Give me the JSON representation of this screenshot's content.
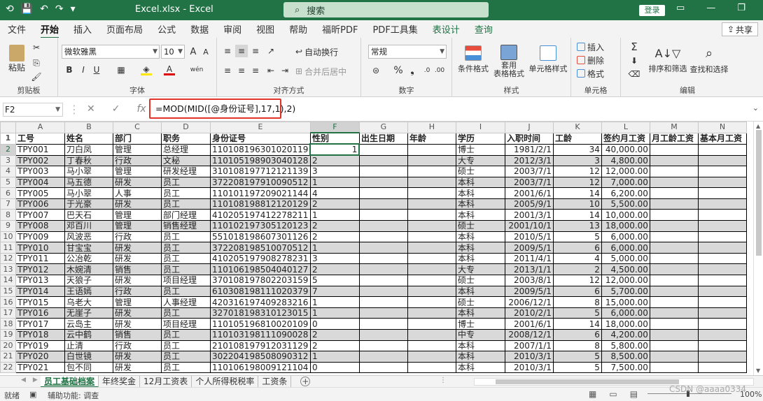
{
  "window": {
    "title": "Excel.xlsx  -  Excel",
    "search_placeholder": "搜索",
    "login": "登录"
  },
  "tabs": [
    "文件",
    "开始",
    "插入",
    "页面布局",
    "公式",
    "数据",
    "审阅",
    "视图",
    "帮助",
    "福昕PDF",
    "PDF工具集",
    "表设计",
    "查询"
  ],
  "share_label": "共享",
  "ribbon": {
    "clipboard": {
      "paste": "粘贴",
      "group": "剪贴板"
    },
    "font": {
      "name": "微软雅黑",
      "size": "10",
      "bold": "B",
      "italic": "I",
      "underline": "U",
      "group": "字体"
    },
    "alignment": {
      "wrap": "自动换行",
      "merge": "合并后居中",
      "group": "对齐方式"
    },
    "number": {
      "format": "常规",
      "group": "数字"
    },
    "styles": {
      "cond": "条件格式",
      "table": "套用\n表格格式",
      "cell": "单元格样式",
      "group": "样式"
    },
    "cells": {
      "insert": "插入",
      "delete": "删除",
      "format": "格式",
      "group": "单元格"
    },
    "editing": {
      "sortfilter": "排序和筛选",
      "findselect": "查找和选择",
      "group": "编辑"
    }
  },
  "formula_bar": {
    "namebox": "F2",
    "formula": "=MOD(MID([@身份证号],17,1),2)"
  },
  "columns": [
    "A",
    "B",
    "C",
    "D",
    "E",
    "F",
    "G",
    "H",
    "I",
    "J",
    "K",
    "L",
    "M",
    "N"
  ],
  "headers": [
    "工号",
    "姓名",
    "部门",
    "职务",
    "身份证号",
    "性别",
    "出生日期",
    "年龄",
    "学历",
    "入职时间",
    "工龄",
    "签约月工资",
    "月工龄工资",
    "基本月工资"
  ],
  "rows": [
    [
      "TPY001",
      "刀白凤",
      "管理",
      "总经理",
      "110108196301020119",
      "1",
      "",
      "",
      "博士",
      "1981/2/1",
      "34",
      "40,000.00",
      "",
      ""
    ],
    [
      "TPY002",
      "丁春秋",
      "行政",
      "文秘",
      "110105198903040128",
      "2",
      "",
      "",
      "大专",
      "2012/3/1",
      "3",
      "4,800.00",
      "",
      ""
    ],
    [
      "TPY003",
      "马小翠",
      "管理",
      "研发经理",
      "310108197712121139",
      "3",
      "",
      "",
      "硕士",
      "2003/7/1",
      "12",
      "12,000.00",
      "",
      ""
    ],
    [
      "TPY004",
      "马五德",
      "研发",
      "员工",
      "372208197910090512",
      "1",
      "",
      "",
      "本科",
      "2003/7/1",
      "12",
      "7,000.00",
      "",
      ""
    ],
    [
      "TPY005",
      "马小翠",
      "人事",
      "员工",
      "110101197209021144",
      "4",
      "",
      "",
      "本科",
      "2001/6/1",
      "14",
      "6,200.00",
      "",
      ""
    ],
    [
      "TPY006",
      "于光豪",
      "研发",
      "员工",
      "110108198812120129",
      "2",
      "",
      "",
      "本科",
      "2005/9/1",
      "10",
      "5,500.00",
      "",
      ""
    ],
    [
      "TPY007",
      "巴天石",
      "管理",
      "部门经理",
      "410205197412278211",
      "1",
      "",
      "",
      "本科",
      "2001/3/1",
      "14",
      "10,000.00",
      "",
      ""
    ],
    [
      "TPY008",
      "邓百川",
      "管理",
      "销售经理",
      "110102197305120123",
      "2",
      "",
      "",
      "硕士",
      "2001/10/1",
      "13",
      "18,000.00",
      "",
      ""
    ],
    [
      "TPY009",
      "风波恶",
      "行政",
      "员工",
      "551018198607301126",
      "2",
      "",
      "",
      "本科",
      "2010/5/1",
      "5",
      "6,000.00",
      "",
      ""
    ],
    [
      "TPY010",
      "甘宝宝",
      "研发",
      "员工",
      "372208198510070512",
      "1",
      "",
      "",
      "本科",
      "2009/5/1",
      "6",
      "6,000.00",
      "",
      ""
    ],
    [
      "TPY011",
      "公冶乾",
      "研发",
      "员工",
      "410205197908278231",
      "3",
      "",
      "",
      "本科",
      "2011/4/1",
      "4",
      "5,000.00",
      "",
      ""
    ],
    [
      "TPY012",
      "木婉清",
      "销售",
      "员工",
      "110106198504040127",
      "2",
      "",
      "",
      "大专",
      "2013/1/1",
      "2",
      "4,500.00",
      "",
      ""
    ],
    [
      "TPY013",
      "天狼子",
      "研发",
      "项目经理",
      "370108197802203159",
      "5",
      "",
      "",
      "硕士",
      "2003/8/1",
      "12",
      "12,000.00",
      "",
      ""
    ],
    [
      "TPY014",
      "王语嫣",
      "行政",
      "员工",
      "610308198111020379",
      "7",
      "",
      "",
      "本科",
      "2009/5/1",
      "6",
      "5,700.00",
      "",
      ""
    ],
    [
      "TPY015",
      "乌老大",
      "管理",
      "人事经理",
      "420316197409283216",
      "1",
      "",
      "",
      "硕士",
      "2006/12/1",
      "8",
      "15,000.00",
      "",
      ""
    ],
    [
      "TPY016",
      "无崖子",
      "研发",
      "员工",
      "327018198310123015",
      "1",
      "",
      "",
      "本科",
      "2010/2/1",
      "5",
      "6,000.00",
      "",
      ""
    ],
    [
      "TPY017",
      "云岛主",
      "研发",
      "项目经理",
      "110105196810020109",
      "0",
      "",
      "",
      "博士",
      "2001/6/1",
      "14",
      "18,000.00",
      "",
      ""
    ],
    [
      "TPY018",
      "云中鹤",
      "销售",
      "员工",
      "110103198111090028",
      "2",
      "",
      "",
      "中专",
      "2008/12/1",
      "6",
      "4,200.00",
      "",
      ""
    ],
    [
      "TPY019",
      "止清",
      "行政",
      "员工",
      "210108197912031129",
      "2",
      "",
      "",
      "本科",
      "2007/1/1",
      "8",
      "5,800.00",
      "",
      ""
    ],
    [
      "TPY020",
      "白世镜",
      "研发",
      "员工",
      "302204198508090312",
      "1",
      "",
      "",
      "本科",
      "2010/3/1",
      "5",
      "8,500.00",
      "",
      ""
    ],
    [
      "TPY021",
      "包不同",
      "研发",
      "员工",
      "110106198009121104",
      "0",
      "",
      "",
      "本科",
      "2010/3/1",
      "5",
      "7,500.00",
      "",
      ""
    ]
  ],
  "sheets": [
    "员工基础档案",
    "年终奖金",
    "12月工资表",
    "个人所得税税率",
    "工资条"
  ],
  "status": {
    "ready": "就绪",
    "accessibility": "辅助功能: 调查",
    "zoom": "100%",
    "watermark": "CSDN @aaaa0334"
  }
}
